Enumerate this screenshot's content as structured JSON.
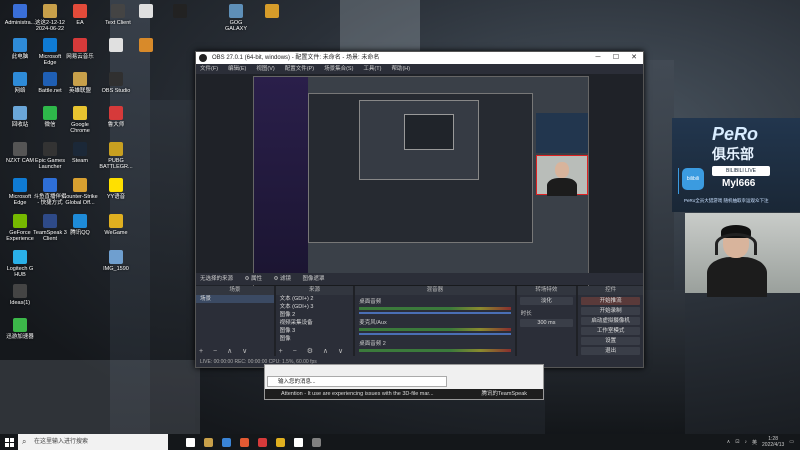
{
  "desktop": {
    "icons": [
      {
        "label": "Administra..."
      },
      {
        "label": "这这2-12-12 2024-06-22"
      },
      {
        "label": "EA"
      },
      {
        "label": "Text Client"
      },
      {
        "label": ""
      },
      {
        "label": ""
      },
      {
        "label": "GOG GALAXY"
      },
      {
        "label": ""
      },
      {
        "label": "此电脑"
      },
      {
        "label": "Microsoft Edge"
      },
      {
        "label": "网易云音乐"
      },
      {
        "label": ""
      },
      {
        "label": ""
      },
      {
        "label": "网络"
      },
      {
        "label": "Battle.net"
      },
      {
        "label": "英雄联盟"
      },
      {
        "label": "OBS Studio"
      },
      {
        "label": "回收站"
      },
      {
        "label": "微信"
      },
      {
        "label": "Google Chrome"
      },
      {
        "label": "鲁大师"
      },
      {
        "label": "NZXT CAM"
      },
      {
        "label": "Epic Games Launcher"
      },
      {
        "label": "Steam"
      },
      {
        "label": "PUBG BATTLEGR..."
      },
      {
        "label": "Microsoft Edge"
      },
      {
        "label": "斗鱼直播伴侣 - 快捷方式"
      },
      {
        "label": "Counter-Strike Global Off..."
      },
      {
        "label": "腾讯QQ"
      },
      {
        "label": "GeForce Experience"
      },
      {
        "label": "TeamSpeak 3 Client"
      },
      {
        "label": "WeGame"
      },
      {
        "label": "YY语音"
      },
      {
        "label": "Logitech G HUB"
      },
      {
        "label": "IMG_1590"
      },
      {
        "label": "Ideas(1)"
      },
      {
        "label": "迅游加速器"
      }
    ]
  },
  "obs": {
    "title": "OBS 27.0.1 (64-bit, windows) - 配置文件: 未命名 - 场景: 未命名",
    "menu": [
      "文件(F)",
      "编辑(E)",
      "视图(V)",
      "配置文件(P)",
      "场景集合(S)",
      "工具(T)",
      "帮助(H)"
    ],
    "scenebar": [
      "无选择的来源",
      "⚙ 属性",
      "⚙ 滤镜",
      "图像遮罩"
    ],
    "docks": {
      "scenes": {
        "header": "场景",
        "items": [
          "场景"
        ],
        "footer": "+ − ∧ ∨"
      },
      "sources": {
        "header": "来源",
        "items": [
          "文本 (GDI+) 2",
          "文本 (GDI+) 3",
          "图像 2",
          "视频采集设备",
          "图像 3",
          "图像"
        ],
        "footer": "+ − ⚙ ∧ ∨"
      },
      "mixer": {
        "header": "混音器",
        "tracks": [
          {
            "name": "桌面音频",
            "level": "0.0 dB"
          },
          {
            "name": "麦克风/Aux",
            "level": "0.0 dB"
          },
          {
            "name": "桌面音频 2",
            "level": ""
          }
        ]
      },
      "transitions": {
        "header": "转场特效",
        "fade": "淡化",
        "duration_label": "时长",
        "duration": "300 ms"
      },
      "controls": {
        "header": "控件",
        "buttons": [
          "开始推流",
          "开始录制",
          "启动虚拟摄像机",
          "工作室模式",
          "设置",
          "退出"
        ]
      }
    },
    "status": "LIVE: 00:00:00   REC: 00:00:00   CPU: 1.5%, 60.00 fps"
  },
  "brand": {
    "logo_en": "PeRo",
    "logo_cn": "俱乐部",
    "bili": "bilibili",
    "tag": "BILIBILI LIVE",
    "streamer_id": "Myl666",
    "slogan": "PeRo全员大猎游戏   随机抽取幸运观众下注"
  },
  "chat": {
    "placeholder": "输入您的消息...",
    "message": "Attention - It use are experiencing issues with the 3D-file mar...",
    "app": "腾讯的TeamSpeak"
  },
  "taskbar": {
    "search_placeholder": "在这里输入进行搜索",
    "time": "1:28",
    "date": "2022/4/13",
    "lang": "英",
    "app_colors": [
      "#ffffff",
      "#c8a04a",
      "#3a84d6",
      "#e35a33",
      "#d63a3a",
      "#e0b020",
      "#ffffff",
      "#808080"
    ]
  }
}
